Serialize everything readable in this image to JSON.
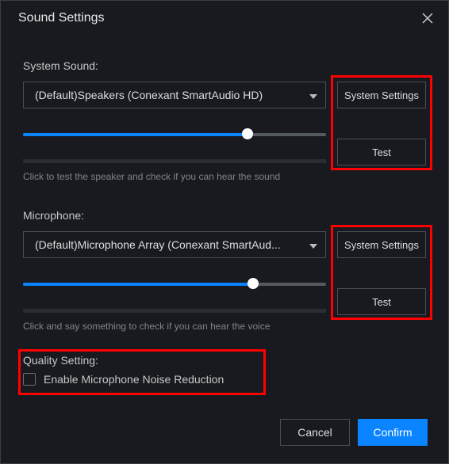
{
  "title": "Sound Settings",
  "systemSound": {
    "label": "System Sound:",
    "selected": "(Default)Speakers (Conexant SmartAudio HD)",
    "sliderPercent": 74,
    "hint": "Click to test the speaker and check if you can hear the sound",
    "settingsButton": "System Settings",
    "testButton": "Test"
  },
  "microphone": {
    "label": "Microphone:",
    "selected": "(Default)Microphone Array (Conexant SmartAud...",
    "sliderPercent": 76,
    "hint": "Click and say something to check if you can hear the voice",
    "settingsButton": "System Settings",
    "testButton": "Test"
  },
  "quality": {
    "label": "Quality Setting:",
    "noiseReductionLabel": "Enable Microphone Noise Reduction",
    "noiseReductionChecked": false
  },
  "footer": {
    "cancel": "Cancel",
    "confirm": "Confirm"
  },
  "colors": {
    "accent": "#0a84ff",
    "highlight": "#ff0000"
  }
}
